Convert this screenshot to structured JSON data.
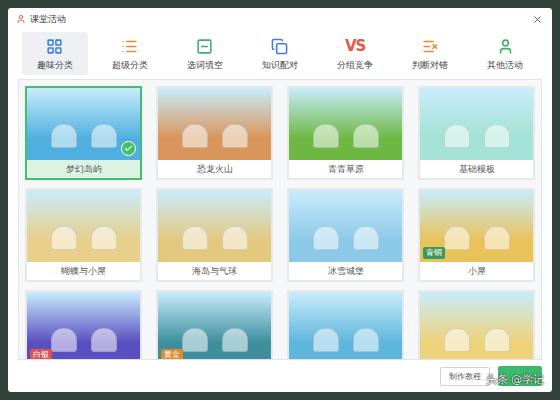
{
  "window": {
    "title": "课堂活动",
    "close": "×"
  },
  "tabs": [
    {
      "label": "趣味分类",
      "selected": true,
      "icon_text": null
    },
    {
      "label": "超级分类",
      "selected": false,
      "icon_text": null
    },
    {
      "label": "选词填空",
      "selected": false,
      "icon_text": null
    },
    {
      "label": "知识配对",
      "selected": false,
      "icon_text": null
    },
    {
      "label": "分组竞争",
      "selected": false,
      "icon_text": "VS"
    },
    {
      "label": "判断对错",
      "selected": false,
      "icon_text": null
    },
    {
      "label": "其他活动",
      "selected": false,
      "icon_text": null
    }
  ],
  "templates": [
    {
      "label": "梦幻岛屿",
      "selected": true,
      "badge": null,
      "badge_color": null,
      "color": "#4fb0e0"
    },
    {
      "label": "恐龙火山",
      "selected": false,
      "badge": null,
      "badge_color": null,
      "color": "#d9955a"
    },
    {
      "label": "青青草原",
      "selected": false,
      "badge": null,
      "badge_color": null,
      "color": "#6cb843"
    },
    {
      "label": "基础模板",
      "selected": false,
      "badge": null,
      "badge_color": null,
      "color": "#a3e2d4"
    },
    {
      "label": "蝴蝶与小屋",
      "selected": false,
      "badge": null,
      "badge_color": null,
      "color": "#e8cf8a"
    },
    {
      "label": "海岛与气球",
      "selected": false,
      "badge": null,
      "badge_color": null,
      "color": "#e3c97e"
    },
    {
      "label": "冰雪城堡",
      "selected": false,
      "badge": null,
      "badge_color": null,
      "color": "#8cc9e8"
    },
    {
      "label": "小屋",
      "selected": false,
      "badge": "青铜",
      "badge_color": "#3a9a5b",
      "color": "#e9c25a"
    },
    {
      "label": "",
      "selected": false,
      "badge": "白银",
      "badge_color": "#d9534f",
      "color": "#5a4fc0"
    },
    {
      "label": "",
      "selected": false,
      "badge": "黄金",
      "badge_color": "#e08a2e",
      "color": "#3d8f9e"
    },
    {
      "label": "",
      "selected": false,
      "badge": null,
      "badge_color": null,
      "color": "#5fb6dd"
    },
    {
      "label": "",
      "selected": false,
      "badge": null,
      "badge_color": null,
      "color": "#eed27a"
    }
  ],
  "footer": {
    "tutorial_button": "制作教程"
  },
  "watermark": "头条 @学记"
}
